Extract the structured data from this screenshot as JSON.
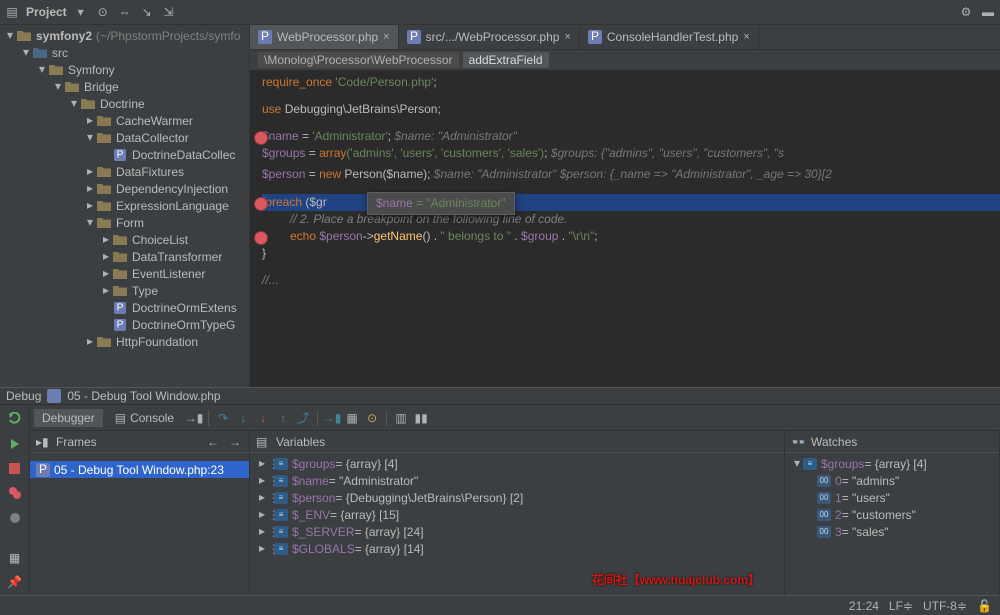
{
  "toolbar": {
    "label": "Project"
  },
  "project": {
    "root": "symfony2",
    "root_path": "(~/PhpstormProjects/symfo",
    "nodes": [
      {
        "l": 1,
        "open": true,
        "type": "folder-src",
        "label": "src"
      },
      {
        "l": 2,
        "open": true,
        "type": "folder",
        "label": "Symfony"
      },
      {
        "l": 3,
        "open": true,
        "type": "folder",
        "label": "Bridge"
      },
      {
        "l": 4,
        "open": true,
        "type": "folder",
        "label": "Doctrine"
      },
      {
        "l": 5,
        "open": false,
        "type": "folder",
        "label": "CacheWarmer"
      },
      {
        "l": 5,
        "open": true,
        "type": "folder",
        "label": "DataCollector"
      },
      {
        "l": 6,
        "open": null,
        "type": "php",
        "label": "DoctrineDataCollec"
      },
      {
        "l": 5,
        "open": false,
        "type": "folder",
        "label": "DataFixtures"
      },
      {
        "l": 5,
        "open": false,
        "type": "folder",
        "label": "DependencyInjection"
      },
      {
        "l": 5,
        "open": false,
        "type": "folder",
        "label": "ExpressionLanguage"
      },
      {
        "l": 5,
        "open": true,
        "type": "folder",
        "label": "Form"
      },
      {
        "l": 6,
        "open": false,
        "type": "folder",
        "label": "ChoiceList"
      },
      {
        "l": 6,
        "open": false,
        "type": "folder",
        "label": "DataTransformer"
      },
      {
        "l": 6,
        "open": false,
        "type": "folder",
        "label": "EventListener"
      },
      {
        "l": 6,
        "open": false,
        "type": "folder",
        "label": "Type"
      },
      {
        "l": 6,
        "open": null,
        "type": "php",
        "label": "DoctrineOrmExtens"
      },
      {
        "l": 6,
        "open": null,
        "type": "php",
        "label": "DoctrineOrmTypeG"
      },
      {
        "l": 5,
        "open": false,
        "type": "folder",
        "label": "HttpFoundation"
      }
    ]
  },
  "tabs": [
    {
      "icon": "php",
      "label": "WebProcessor.php",
      "active": true
    },
    {
      "icon": "php",
      "label": "src/.../WebProcessor.php",
      "active": false
    },
    {
      "icon": "php",
      "label": "ConsoleHandlerTest.php",
      "active": false
    }
  ],
  "breadcrumb": {
    "path": "\\Monolog\\Processor\\WebProcessor",
    "member": "addExtraField"
  },
  "code": {
    "l1": {
      "kw": "require_once",
      "str": "'Code/Person.php'",
      "end": ";"
    },
    "l2": {
      "kw": "use",
      "ns": "Debugging\\JetBrains\\",
      "cls": "Person",
      "end": ";"
    },
    "l3": {
      "var": "$name",
      "eq": " = ",
      "str": "'Administrator'",
      "end": ";",
      "inline": "  $name: \"Administrator\""
    },
    "l4": {
      "var": "$groups",
      "eq": " = ",
      "kw": "array",
      "args": "('admins', 'users', 'customers', 'sales')",
      "end": ";",
      "inline": "  $groups: {\"admins\", \"users\", \"customers\", \"s"
    },
    "l5": {
      "var": "$person",
      "eq": " = ",
      "kw": "new",
      "cls": " Person",
      "args": "($name)",
      "end": ";",
      "inline": "  $name: \"Administrator\"  $person: {_name => \"Administrator\", _age => 30}[2"
    },
    "l6": {
      "kw": "foreach",
      "args": " ($gr"
    },
    "tooltip": {
      "tvar": "$name",
      "eq": " = ",
      "tval": "\"Administrator\""
    },
    "l7": "// 2. Place a breakpoint on the following line of code.",
    "l8": {
      "kw": "echo ",
      "var": "$person",
      "arrow": "->",
      "fn": "getName",
      "args": "() . ",
      "str": "\" belongs to \"",
      "mid": " . ",
      "var2": "$group",
      "mid2": " . ",
      "str2": "\"\\r\\n\"",
      "end": ";"
    },
    "l9": "}",
    "l10": "//..."
  },
  "debug": {
    "title": "Debug",
    "session_icon_label": "05 - Debug Tool Window.php",
    "tabs": {
      "debugger": "Debugger",
      "console": "Console"
    },
    "frames": {
      "title": "Frames",
      "items": [
        {
          "label": "05 - Debug Tool Window.php:23",
          "selected": true
        }
      ]
    },
    "variables": {
      "title": "Variables",
      "items": [
        {
          "name": "$groups",
          "val": " = {array} [4]"
        },
        {
          "name": "$name",
          "val": " = \"Administrator\""
        },
        {
          "name": "$person",
          "val": " = {Debugging\\JetBrains\\Person} [2]"
        },
        {
          "name": "$_ENV",
          "val": " = {array} [15]"
        },
        {
          "name": "$_SERVER",
          "val": " = {array} [24]"
        },
        {
          "name": "$GLOBALS",
          "val": " = {array} [14]"
        }
      ]
    },
    "watches": {
      "title": "Watches",
      "root": {
        "name": "$groups",
        "val": " = {array} [4]"
      },
      "items": [
        {
          "idx": "0",
          "val": " = \"admins\""
        },
        {
          "idx": "1",
          "val": " = \"users\""
        },
        {
          "idx": "2",
          "val": " = \"customers\""
        },
        {
          "idx": "3",
          "val": " = \"sales\""
        }
      ]
    }
  },
  "status": {
    "caret": "21:24",
    "le": "LF≑",
    "enc": "UTF-8≑",
    "lock": "🔓"
  },
  "overlay": {
    "t1": "花间社",
    "t2": "【www.huajclub.com】"
  }
}
